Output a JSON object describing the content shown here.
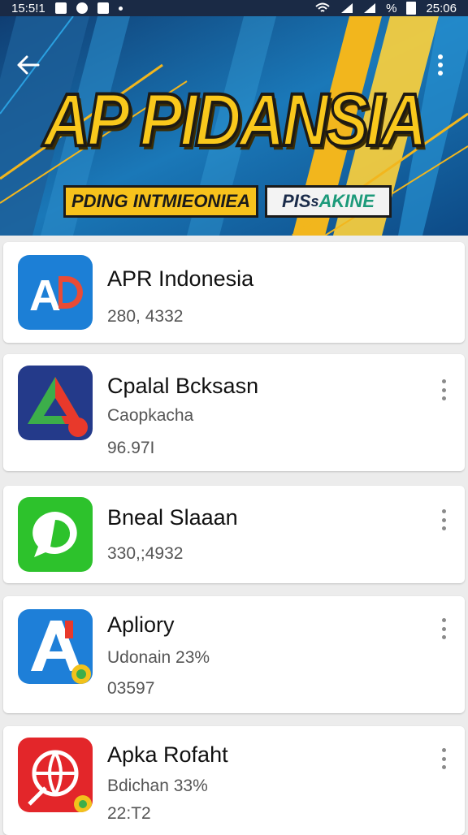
{
  "status_bar": {
    "time_left": "15:5!1",
    "signal_text": "%",
    "time_right": "25:06"
  },
  "header": {
    "back_icon": "arrow-left-icon",
    "menu_icon": "more-vert-icon",
    "banner_title": "AP PIDANSIA",
    "tag_left": "PDING INTMIEONIEA",
    "tag_right_a": "PIS",
    "tag_right_b": "s",
    "tag_right_c": " AKINE"
  },
  "apps": [
    {
      "name": "APR Indonesia",
      "line2": "280, 4332",
      "line3": "",
      "icon": "ad-logo-icon",
      "has_menu": false
    },
    {
      "name": "Cpalal Bcksasn",
      "line2": "Caopkacha",
      "line3": "96.97I",
      "icon": "triangle-logo-icon",
      "has_menu": true
    },
    {
      "name": "Bneal Slaaan",
      "line2": "330,;4932",
      "line3": "",
      "icon": "chat-bubble-icon",
      "has_menu": true
    },
    {
      "name": "Apliory",
      "line2": "Udonain 23%",
      "line3": "03597",
      "icon": "letter-a-icon",
      "has_menu": true
    },
    {
      "name": "Apka Rofaht",
      "line2": "Bdichan 33%",
      "line3": "22:T2",
      "icon": "globe-logo-icon",
      "has_menu": true
    }
  ]
}
